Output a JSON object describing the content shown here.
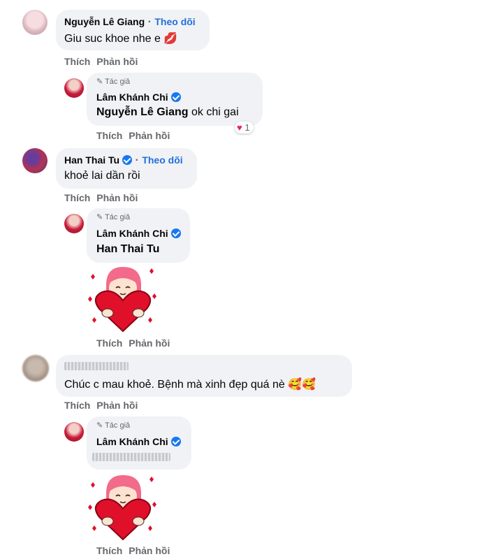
{
  "comments": [
    {
      "author": "Nguyễn Lê Giang",
      "follow": "Theo dõi",
      "text": "Giu suc khoe nhe e",
      "emoji": "💋",
      "actions": {
        "like": "Thích",
        "reply": "Phản hồi"
      },
      "reply": {
        "tag": "Tác giả",
        "author": "Lâm Khánh Chi",
        "mention": "Nguyễn Lê Giang",
        "text": "ok chi gai",
        "reaction_count": "1",
        "actions": {
          "like": "Thích",
          "reply": "Phản hồi"
        }
      }
    },
    {
      "author": "Han Thai Tu",
      "follow": "Theo dõi",
      "text": "khoẻ lai dần rồi",
      "actions": {
        "like": "Thích",
        "reply": "Phản hồi"
      },
      "reply": {
        "tag": "Tác giả",
        "author": "Lâm Khánh Chi",
        "mention": "Han Thai Tu",
        "sticker": "heart-girl-sticker",
        "actions": {
          "like": "Thích",
          "reply": "Phản hồi"
        }
      }
    },
    {
      "author": "",
      "text": "Chúc c mau khoẻ. Bệnh mà xinh đẹp quá nè",
      "emoji": "🥰🥰",
      "actions": {
        "like": "Thích",
        "reply": "Phản hồi"
      },
      "reply": {
        "tag": "Tác giả",
        "author": "Lâm Khánh Chi",
        "sticker": "heart-girl-sticker",
        "actions": {
          "like": "Thích",
          "reply": "Phản hồi"
        }
      }
    }
  ],
  "colors": {
    "bubble": "#f0f2f5",
    "link": "#216fdb",
    "verified": "#1877f2",
    "heart": "#e0245e"
  }
}
